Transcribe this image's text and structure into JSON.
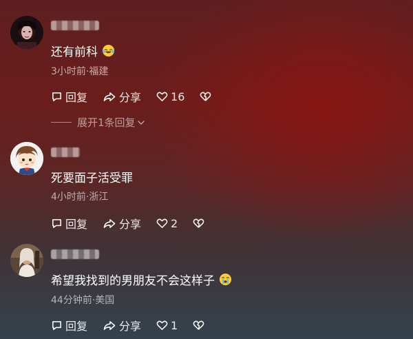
{
  "comments": [
    {
      "text": "还有前科",
      "emoji": "laughing-crying-emoji",
      "meta": "3小时前·福建",
      "reply_label": "回复",
      "share_label": "分享",
      "like_count": "16"
    },
    {
      "text": "死要面子活受罪",
      "emoji": "",
      "meta": "4小时前·浙江",
      "reply_label": "回复",
      "share_label": "分享",
      "like_count": "2"
    },
    {
      "text": "希望我找到的男朋友不会这样子",
      "emoji": "crying-emoji",
      "meta": "44分钟前·美国",
      "reply_label": "回复",
      "share_label": "分享",
      "like_count": "1"
    }
  ],
  "expand_replies": {
    "label": "展开1条回复"
  },
  "icons": {
    "reply": "reply-icon",
    "share": "share-icon",
    "like": "heart-icon",
    "dislike": "broken-heart-icon",
    "expand": "chevron-down-icon"
  }
}
